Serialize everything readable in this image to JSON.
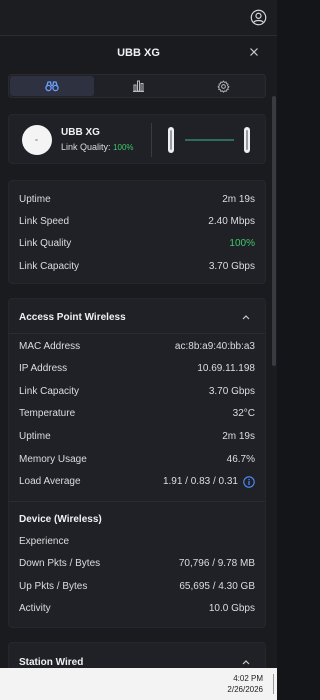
{
  "panel": {
    "title": "UBB XG"
  },
  "tabs": [
    {
      "name": "binoculars-icon",
      "active": true
    },
    {
      "name": "bar-chart-icon",
      "active": false
    },
    {
      "name": "gear-icon",
      "active": false
    }
  ],
  "device": {
    "name": "UBB XG",
    "link_quality_label": "Link Quality:",
    "link_quality_value": "100%"
  },
  "stats": [
    {
      "label": "Uptime",
      "value": "2m 19s"
    },
    {
      "label": "Link Speed",
      "value": "2.40 Mbps"
    },
    {
      "label": "Link Quality",
      "value": "100%"
    },
    {
      "label": "Link Capacity",
      "value": "3.70 Gbps"
    }
  ],
  "ap_wireless": {
    "title": "Access Point Wireless",
    "rows": [
      {
        "label": "MAC Address",
        "value": "ac:8b:a9:40:bb:a3"
      },
      {
        "label": "IP Address",
        "value": "10.69.11.198"
      },
      {
        "label": "Link Capacity",
        "value": "3.70 Gbps"
      },
      {
        "label": "Temperature",
        "value": "32°C"
      },
      {
        "label": "Uptime",
        "value": "2m 19s"
      },
      {
        "label": "Memory Usage",
        "value": "46.7%"
      },
      {
        "label": "Load Average",
        "value": "1.91 / 0.83 / 0.31"
      }
    ]
  },
  "device_wireless": {
    "title": "Device (Wireless)",
    "rows": [
      {
        "label": "Experience",
        "value": ""
      },
      {
        "label": "Down Pkts / Bytes",
        "value": "70,796 / 9.78 MB"
      },
      {
        "label": "Up Pkts / Bytes",
        "value": "65,695 / 4.30 GB"
      },
      {
        "label": "Activity",
        "value": "10.0 Gbps"
      }
    ]
  },
  "station_wired": {
    "title": "Station Wired"
  },
  "taskbar": {
    "time": "4:02 PM",
    "date": "2/26/2026"
  },
  "colors": {
    "accent": "#4f8cff",
    "good": "#3fc76a",
    "background": "#1a1b1f"
  }
}
